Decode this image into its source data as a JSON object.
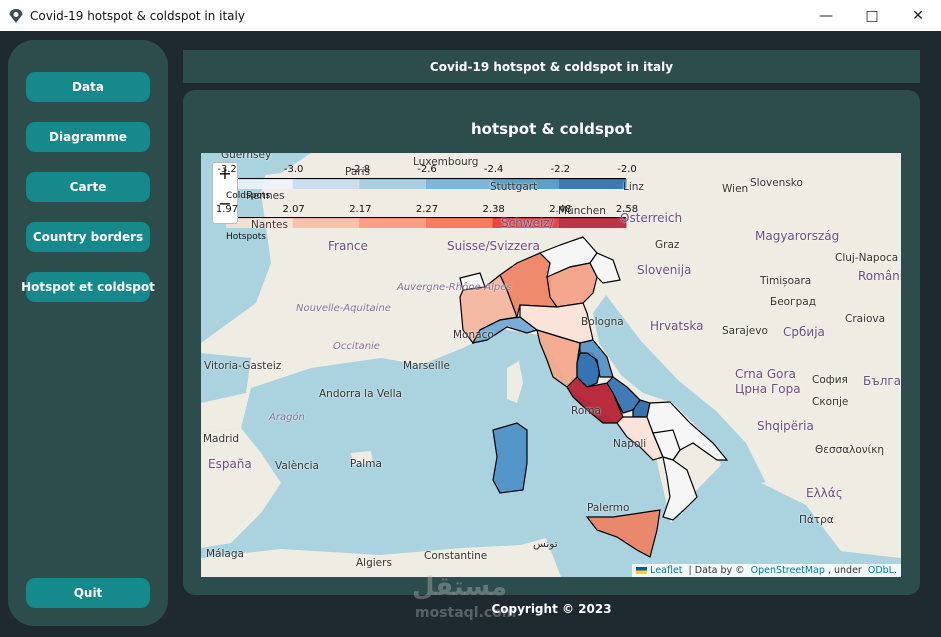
{
  "window": {
    "title": "Covid-19 hotspot & coldspot in italy",
    "controls": [
      "minimize",
      "maximize",
      "close"
    ]
  },
  "sidebar": {
    "items": [
      {
        "label": "Data"
      },
      {
        "label": "Diagramme"
      },
      {
        "label": "Carte"
      },
      {
        "label": "Country borders"
      },
      {
        "label": "Hotspot et coldspot"
      }
    ],
    "quit_label": "Quit"
  },
  "header": {
    "title": "Covid-19 hotspot & coldspot in italy"
  },
  "panel": {
    "title": "hotspot & coldspot"
  },
  "map": {
    "zoom_in": "+",
    "zoom_out": "−",
    "legend": {
      "coldspots": {
        "caption": "Coldspots",
        "ticks": [
          "-3.2",
          "-3.0",
          "-2.8",
          "-2.6",
          "-2.4",
          "-2.2",
          "-2.0"
        ],
        "colors": [
          "#eef3fb",
          "#c6dbef",
          "#9ecae1",
          "#6baed6",
          "#4292c6",
          "#2166ac"
        ]
      },
      "hotspots": {
        "caption": "Hotspots",
        "ticks": [
          "1.97",
          "2.07",
          "2.17",
          "2.27",
          "2.38",
          "2.48",
          "2.58"
        ],
        "colors": [
          "#fee0d2",
          "#fcbba1",
          "#fc9272",
          "#fb6a4a",
          "#de2d26",
          "#b2182b"
        ]
      }
    },
    "labels": [
      "Paris",
      "Luxembourg",
      "Stuttgart",
      "Linz",
      "Wien",
      "Slovensko",
      "Österreich",
      "München",
      "Magyarország",
      "Graz",
      "Cluj-Napoca",
      "România",
      "Timișoara",
      "Београд",
      "Србија",
      "Sarajevo",
      "Hrvatska",
      "Slovenija",
      "Craiova",
      "Crna Gora",
      "Црна Гора",
      "София",
      "България",
      "Скопје",
      "Shqipëria",
      "Θεσσαλονίκη",
      "Ελλάς",
      "Πάτρα",
      "France",
      "Nouvelle-Aquitaine",
      "Occitanie",
      "Auvergne-Rhône-Alpes",
      "Marseille",
      "Monaco",
      "Vitoria-Gasteiz",
      "Andorra la Vella",
      "Aragón",
      "Madrid",
      "España",
      "València",
      "Palma",
      "Palermo",
      "Roma",
      "Napoli",
      "Bologna",
      "Málaga",
      "Algiers",
      "Constantine",
      "تونس",
      "Schweiz/",
      "Suisse/Svizzera",
      "Rennes",
      "Nantes",
      "Guernsey"
    ],
    "attribution": {
      "leaflet": "Leaflet",
      "text1": " | Data by © ",
      "osm": "OpenStreetMap",
      "text2": ", under ",
      "odbl": "ODbL."
    },
    "regions": {
      "aosta": "#f7f7f7",
      "piemonte": "#f4b49a",
      "liguria": "#6aa6d5",
      "lombardia": "#f0805f",
      "trentino": "#f7f7f7",
      "veneto": "#f4a082",
      "friuli": "#f7f7f7",
      "emilia": "#fbe2d6",
      "toscana": "#f4a68a",
      "umbria": "#2166ac",
      "marche": "#4d8fc6",
      "lazio": "#b2182b",
      "abruzzo": "#2c6fb0",
      "molise": "#2166ac",
      "campania": "#fbe2d6",
      "puglia": "#f7f7f7",
      "basilicata": "#f7f7f7",
      "calabria": "#f7f7f7",
      "sicilia": "#f0805f",
      "sardegna": "#4a8fc8"
    },
    "colors": {
      "sea": "#aad3df",
      "land": "#efece3"
    }
  },
  "footer": {
    "copyright": "Copyright © 2023"
  },
  "watermark": {
    "arabic": "مستقل",
    "latin": "mostaql.com"
  }
}
